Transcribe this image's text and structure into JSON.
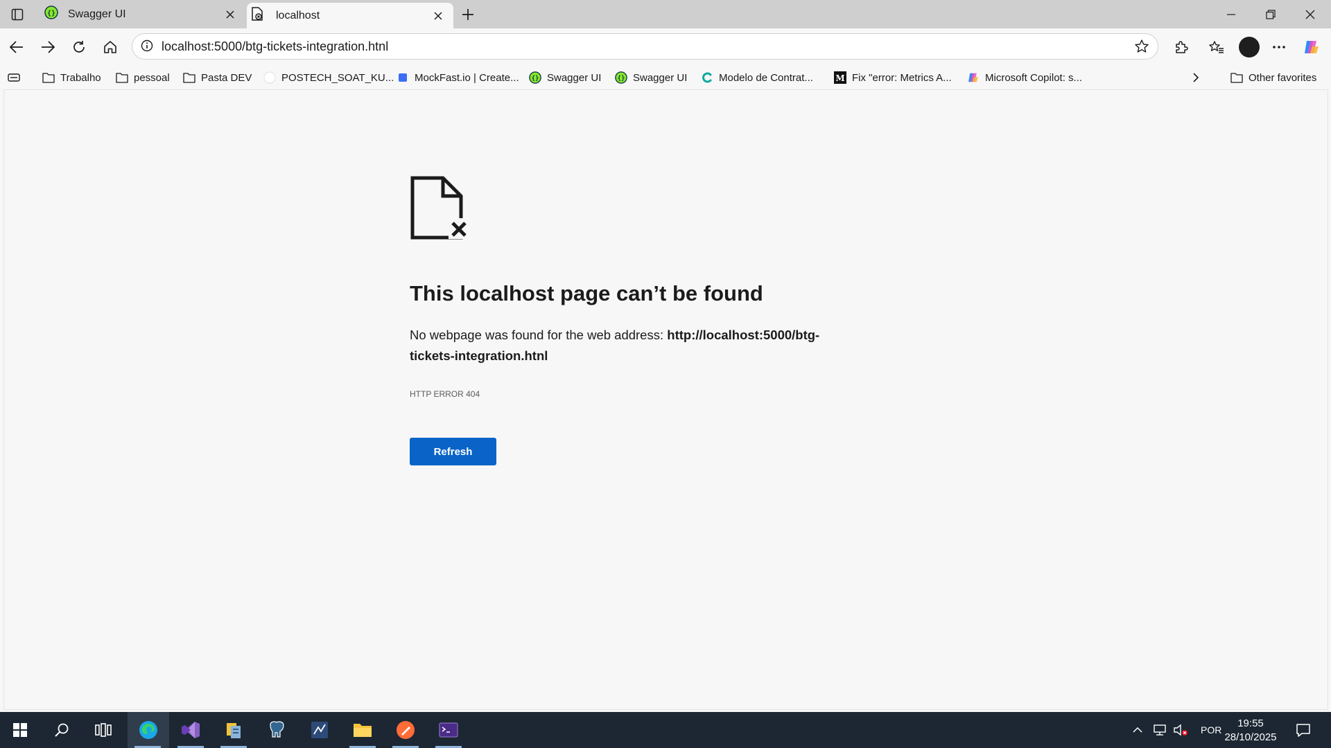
{
  "browser": {
    "tabs": [
      {
        "title": "Swagger UI",
        "icon": "swagger-icon",
        "active": false
      },
      {
        "title": "localhost",
        "icon": "broken-page-icon",
        "active": true
      }
    ],
    "address_bar": {
      "url": "localhost:5000/btg-tickets-integration.htnl"
    },
    "bookmarks": [
      {
        "label": "Trabalho",
        "icon": "folder-icon"
      },
      {
        "label": "pessoal",
        "icon": "folder-icon"
      },
      {
        "label": "Pasta DEV",
        "icon": "folder-icon"
      },
      {
        "label": "POSTECH_SOAT_KU...",
        "icon": "github-icon"
      },
      {
        "label": "MockFast.io | Create...",
        "icon": "mockfast-icon"
      },
      {
        "label": "Swagger UI",
        "icon": "swagger-icon"
      },
      {
        "label": "Swagger UI",
        "icon": "swagger-icon"
      },
      {
        "label": "Modelo de Contrat...",
        "icon": "c-logo-icon"
      },
      {
        "label": "Fix \"error: Metrics A...",
        "icon": "medium-icon"
      },
      {
        "label": "Microsoft Copilot: s...",
        "icon": "copilot-icon"
      }
    ],
    "other_favorites": "Other favorites"
  },
  "page": {
    "title": "This localhost page can’t be found",
    "description_prefix": "No webpage was found for the web address: ",
    "description_url": "http://localhost:5000/btg-tickets-integration.htnl",
    "error_code": "HTTP ERROR 404",
    "refresh_label": "Refresh"
  },
  "taskbar": {
    "language": "POR",
    "time": "19:55",
    "date": "28/10/2025"
  },
  "colors": {
    "accent": "#0a64c8",
    "taskbar": "#1c2733",
    "tabstrip": "#cfcfcf",
    "page_bg": "#f7f7f7"
  }
}
